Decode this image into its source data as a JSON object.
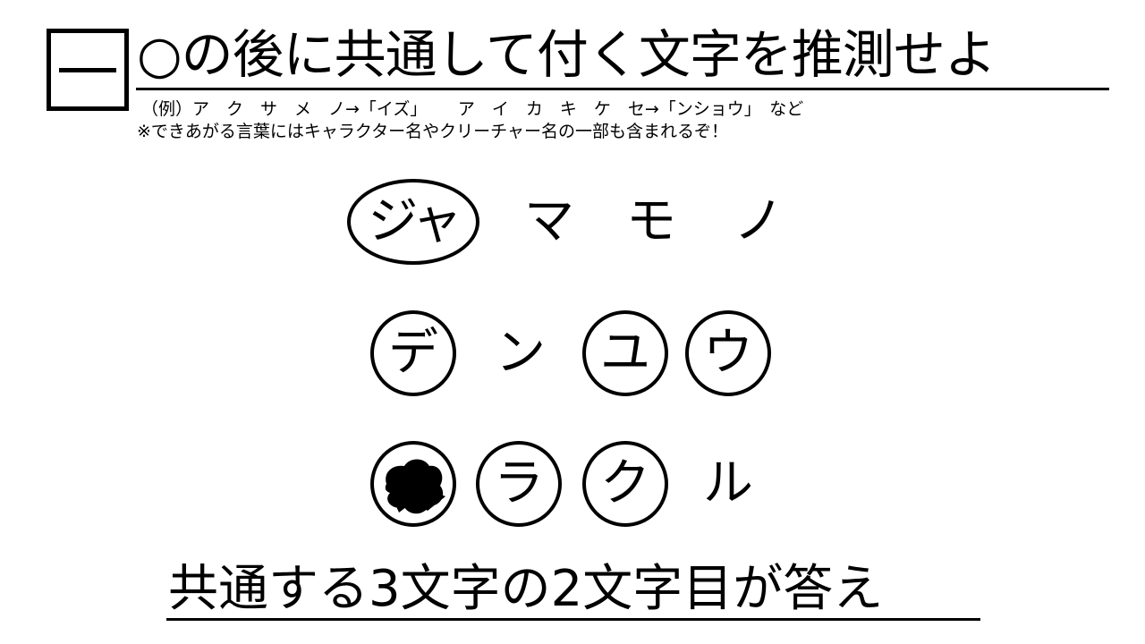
{
  "question_mark": "一",
  "heading": "○の後に共通して付く文字を推測せよ",
  "example": "（例）ア　ク　サ　メ　ノ→「イズ」　　 ア　イ　カ　キ　ケ　セ→「ンショウ」　など",
  "note": "※できあがる言葉にはキャラクター名やクリーチャー名の一部も含まれるぞ！",
  "rows": [
    [
      "ジャ",
      "マ",
      "モ",
      "ノ"
    ],
    [
      "デ",
      "ン",
      "ユ",
      "ウ"
    ],
    [
      "",
      "ラ",
      "ク",
      "ル"
    ]
  ],
  "answer_instruction": "共通する3文字の2文字目が答え"
}
